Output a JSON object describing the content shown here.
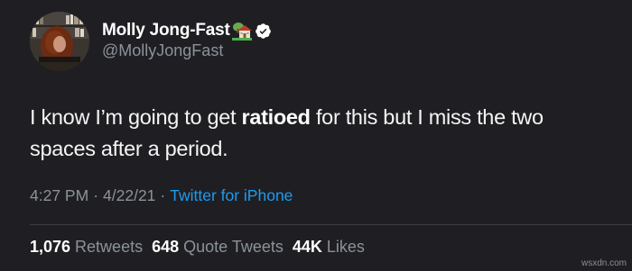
{
  "author": {
    "display_name": "Molly Jong-Fast",
    "handle": "@MollyJongFast",
    "house_emoji": "house-with-garden-icon",
    "verified_icon": "verified-badge-icon"
  },
  "tweet": {
    "text_before": "I know I’m going to get ",
    "text_bold": "ratioed",
    "text_after": " for this but I miss the two spaces after a period."
  },
  "meta": {
    "time": "4:27 PM",
    "separator": "·",
    "date": "4/22/21",
    "separator2": "·",
    "source": "Twitter for iPhone"
  },
  "stats": {
    "retweets_count": "1,076",
    "retweets_label": "Retweets",
    "quotes_count": "648",
    "quotes_label": "Quote Tweets",
    "likes_count": "44K",
    "likes_label": "Likes"
  },
  "watermark": "wsxdn.com",
  "colors": {
    "background": "#1f1f23",
    "secondary_text": "#8b9299",
    "link": "#1d9bf0"
  }
}
